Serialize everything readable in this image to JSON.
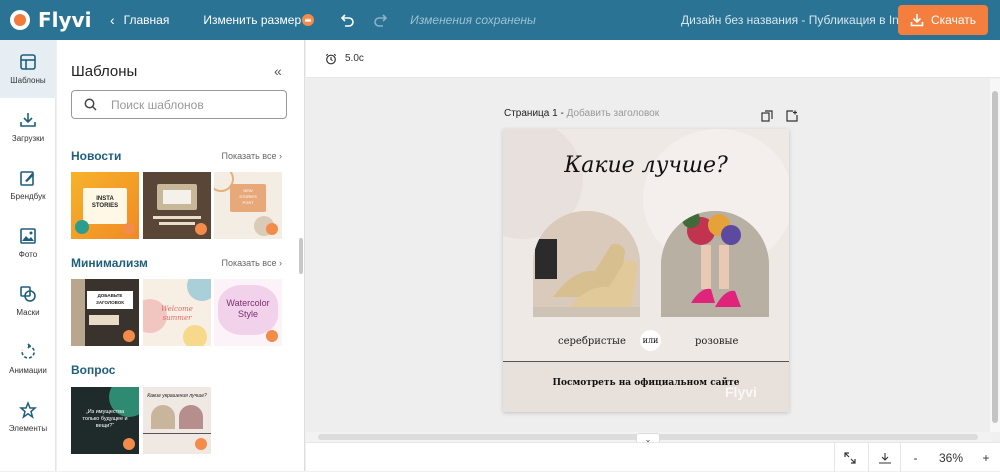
{
  "header": {
    "logo_text": "Flyvi",
    "back_label": "Главная",
    "resize_label": "Изменить размер",
    "saved_status": "Изменения сохранены",
    "document_title": "Дизайн без названия - Публикация в In...",
    "download_label": "Скачать"
  },
  "rail": {
    "items": [
      {
        "label": "Шаблоны",
        "icon": "layout-icon"
      },
      {
        "label": "Загрузки",
        "icon": "upload-icon"
      },
      {
        "label": "Брендбук",
        "icon": "brandbook-icon"
      },
      {
        "label": "Фото",
        "icon": "photo-icon"
      },
      {
        "label": "Маски",
        "icon": "masks-icon"
      },
      {
        "label": "Анимации",
        "icon": "animation-icon"
      },
      {
        "label": "Элементы",
        "icon": "star-icon"
      }
    ]
  },
  "panel": {
    "title": "Шаблоны",
    "search_placeholder": "Поиск шаблонов",
    "sections": [
      {
        "name": "Новости",
        "show_all": "Показать все"
      },
      {
        "name": "Минимализм",
        "show_all": "Показать все"
      },
      {
        "name": "Вопрос",
        "show_all": ""
      }
    ],
    "thumbs": {
      "news1_line1": "INSTA",
      "news1_line2": "STORIES",
      "news3_line1": "NEW",
      "news3_line2": "STORIES",
      "news3_line3": "POST",
      "min1_line1": "ДОБАВЬТЕ",
      "min1_line2": "ЗАГОЛОВОК",
      "min2_line1": "Welcome",
      "min2_line2": "summer",
      "min3_line1": "Watercolor",
      "min3_line2": "Style",
      "q1_text": "„Из имущества только будущее и вещи?“",
      "q2_text": "Какие украшения лучше?"
    }
  },
  "workspace": {
    "duration": "5.0с",
    "page_label": "Страница 1 -",
    "page_add_title": "Добавить заголовок",
    "zoom": "36%",
    "zoom_minus": "-",
    "zoom_plus": "+"
  },
  "poster": {
    "headline": "Какие лучше?",
    "option_left": "серебристые",
    "or": "или",
    "option_right": "розовые",
    "footer": "Посмотреть на официальном сайте",
    "watermark": "Flyvi"
  },
  "colors": {
    "topbar": "#2b7394",
    "accent": "#f47e3d",
    "section_title": "#1f5f7c"
  }
}
